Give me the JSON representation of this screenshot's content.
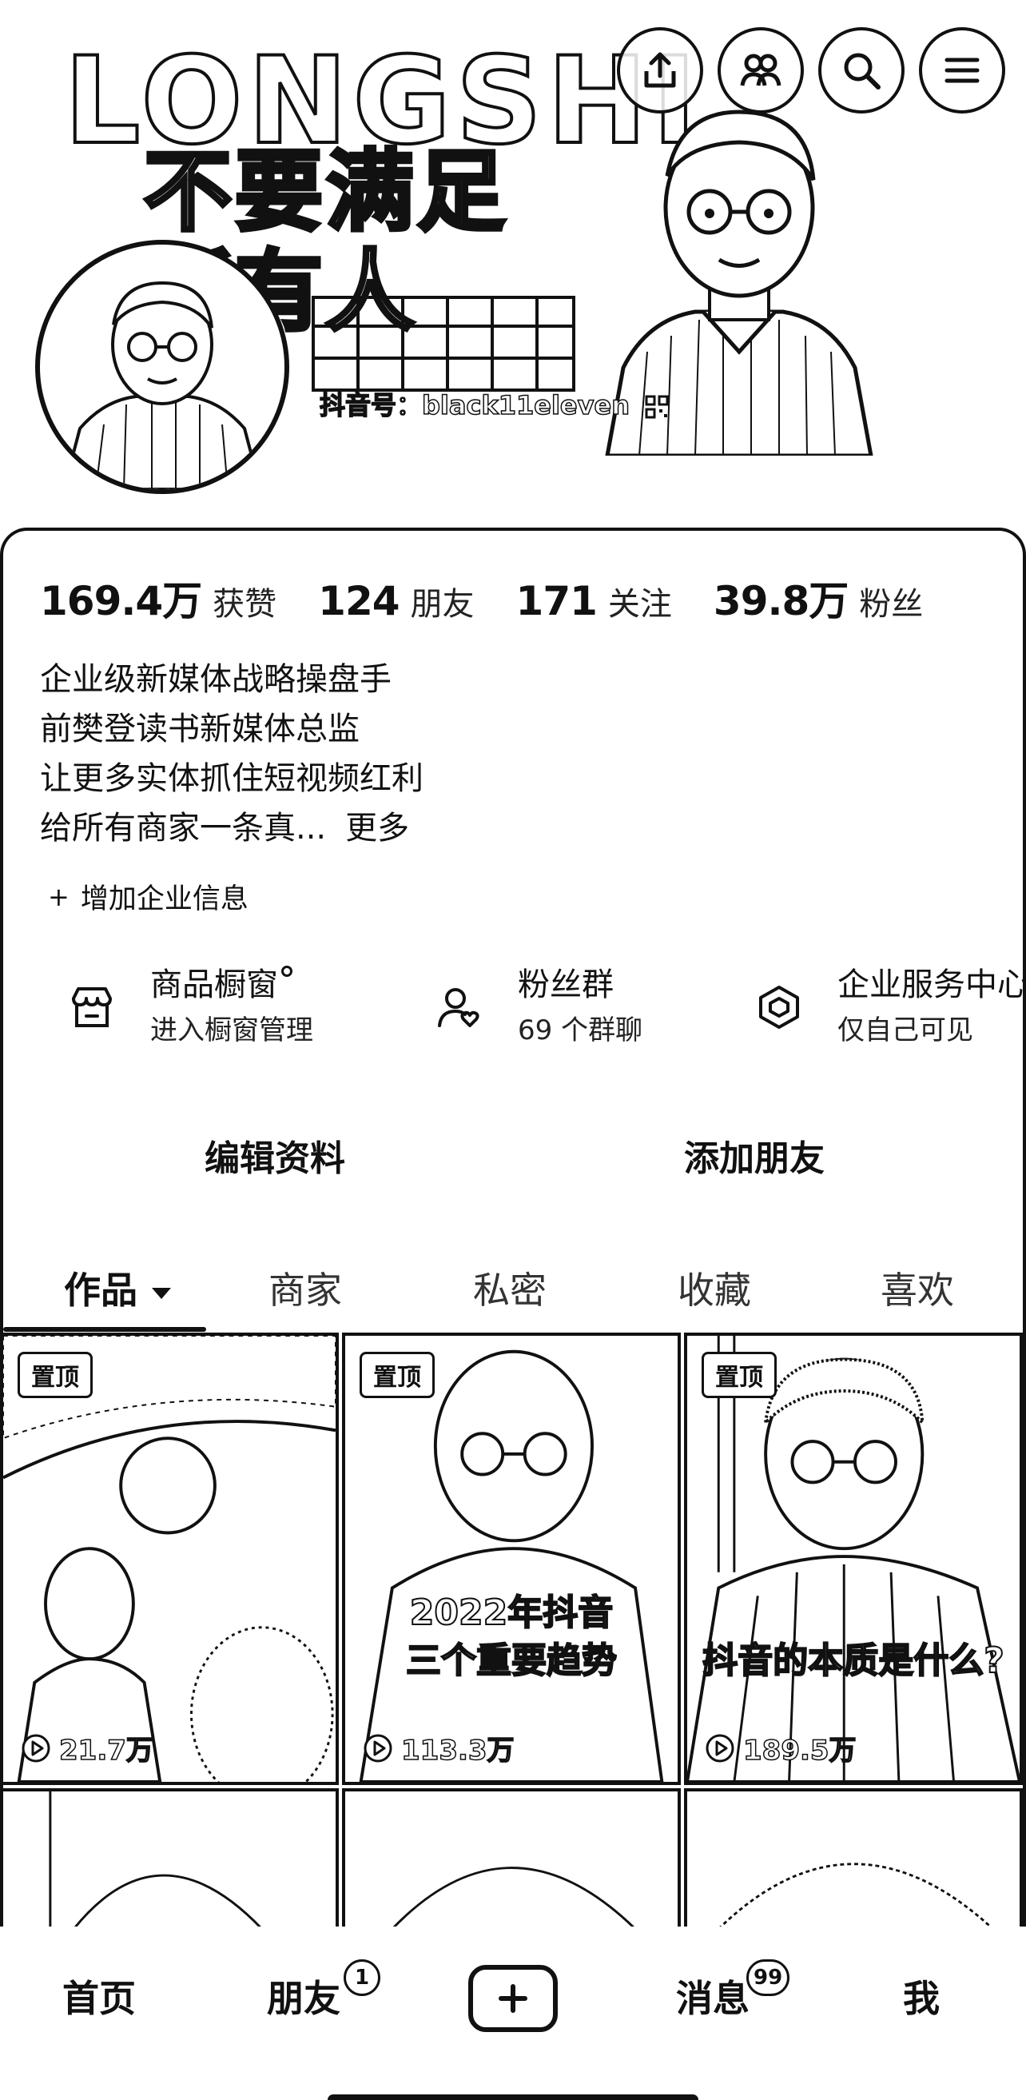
{
  "banner": {
    "big_letters": "LONGSHI",
    "headline_line1": "不要满足",
    "headline_line2": "所有人",
    "douyin_id": "抖音号：black11eleven"
  },
  "top_actions": {
    "icons": [
      "share-icon",
      "friends-icon",
      "search-icon",
      "menu-icon"
    ]
  },
  "stats": [
    {
      "num": "169.4万",
      "label": "获赞"
    },
    {
      "num": "124",
      "label": "朋友"
    },
    {
      "num": "171",
      "label": "关注"
    },
    {
      "num": "39.8万",
      "label": "粉丝"
    }
  ],
  "bio": {
    "line1": "企业级新媒体战略操盘手",
    "line2": "前樊登读书新媒体总监",
    "line3": "让更多实体抓住短视频红利",
    "line4": "给所有商家一条真...",
    "more": "更多"
  },
  "add_company": "增加企业信息",
  "services": [
    {
      "title": "商品橱窗",
      "sub": "进入橱窗管理",
      "icon": "storefront-icon"
    },
    {
      "title": "粉丝群",
      "sub": "69 个群聊",
      "icon": "fan-group-icon"
    },
    {
      "title": "企业服务中心",
      "sub": "仅自己可见",
      "icon": "enterprise-icon"
    }
  ],
  "actions": {
    "edit": "编辑资料",
    "add_friend": "添加朋友"
  },
  "tabs": [
    "作品",
    "商家",
    "私密",
    "收藏",
    "喜欢"
  ],
  "videos": [
    {
      "pin": "置顶",
      "caption": "",
      "views": "21.7万"
    },
    {
      "pin": "置顶",
      "caption1": "2022年抖音",
      "caption2": "三个重要趋势",
      "views": "113.3万"
    },
    {
      "pin": "置顶",
      "caption": "抖音的本质是什么?",
      "views": "189.5万"
    }
  ],
  "bottom_nav": {
    "home": "首页",
    "friends": "朋友",
    "friends_badge": "1",
    "messages": "消息",
    "messages_badge": "99",
    "me": "我"
  },
  "colors": {
    "ink": "#111111",
    "background": "#ffffff"
  }
}
